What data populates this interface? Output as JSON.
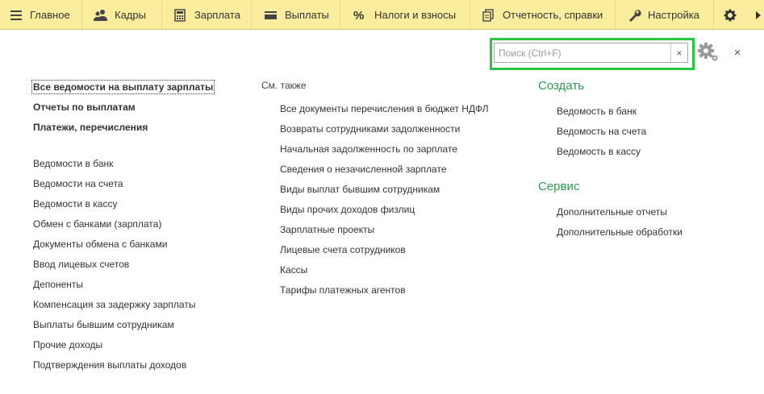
{
  "topbar": {
    "items": [
      {
        "label": "Главное",
        "icon": "hamburger-menu-icon"
      },
      {
        "label": "Кадры",
        "icon": "people-icon"
      },
      {
        "label": "Зарплата",
        "icon": "calculator-icon"
      },
      {
        "label": "Выплаты",
        "icon": "wallet-icon"
      },
      {
        "label": "Налоги и взносы",
        "icon": "percent-icon"
      },
      {
        "label": "Отчетность, справки",
        "icon": "documents-icon"
      },
      {
        "label": "Настройка",
        "icon": "wrench-icon"
      }
    ],
    "extra_icon": "gear-icon",
    "more_icon": "chevron-right-icon"
  },
  "search": {
    "placeholder": "Поиск (Ctrl+F)",
    "value": "",
    "clear_label": "×",
    "highlight_color": "#29c545"
  },
  "close_label": "×",
  "left": {
    "primary": [
      "Все ведомости на выплату зарплаты",
      "Отчеты по выплатам",
      "Платежи, перечисления"
    ],
    "links": [
      "Ведомости в банк",
      "Ведомости на счета",
      "Ведомости в кассу",
      "Обмен с банками (зарплата)",
      "Документы обмена с банками",
      "Ввод лицевых счетов",
      "Депоненты",
      "Компенсация за задержку зарплаты",
      "Выплаты бывшим сотрудникам",
      "Прочие доходы",
      "Подтверждения выплаты доходов"
    ]
  },
  "middle": {
    "heading": "См. также",
    "links": [
      "Все документы перечисления в бюджет НДФЛ",
      "Возвраты сотрудниками задолженности",
      "Начальная задолженность по зарплате",
      "Сведения о незачисленной зарплате",
      "Виды выплат бывшим сотрудникам",
      "Виды прочих доходов физлиц",
      "Зарплатные проекты",
      "Лицевые счета сотрудников",
      "Кассы",
      "Тарифы платежных агентов"
    ]
  },
  "right": {
    "create_heading": "Создать",
    "create_links": [
      "Ведомость в банк",
      "Ведомость на счета",
      "Ведомость в кассу"
    ],
    "service_heading": "Сервис",
    "service_links": [
      "Дополнительные отчеты",
      "Дополнительные обработки"
    ]
  },
  "colors": {
    "topbar_bg": "#fbed9e",
    "section_heading": "#2e9b4f",
    "text": "#333333"
  }
}
